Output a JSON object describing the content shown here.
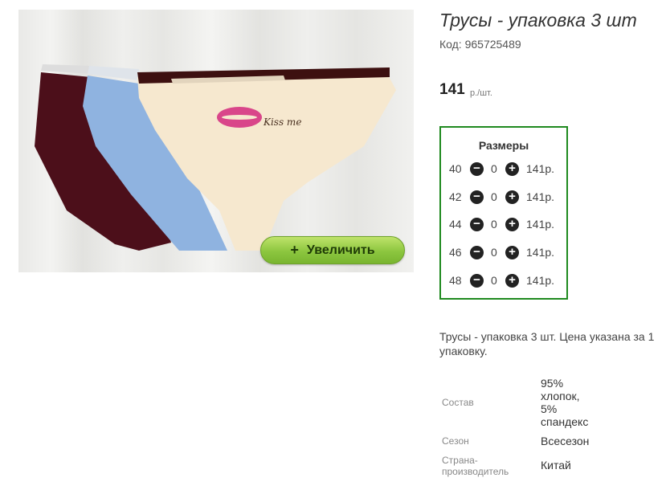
{
  "product": {
    "title": "Трусы - упаковка 3 шт",
    "code": "Код: 965725489",
    "price": "141",
    "price_unit": "р./шт.",
    "zoom_label": "Увеличить",
    "zoom_plus": "+",
    "print_text": "Kiss me"
  },
  "sizes": {
    "title": "Размеры",
    "rows": [
      {
        "size": "40",
        "qty": "0",
        "price": "141р."
      },
      {
        "size": "42",
        "qty": "0",
        "price": "141р."
      },
      {
        "size": "44",
        "qty": "0",
        "price": "141р."
      },
      {
        "size": "46",
        "qty": "0",
        "price": "141р."
      },
      {
        "size": "48",
        "qty": "0",
        "price": "141р."
      }
    ]
  },
  "description": "Трусы - упаковка 3 шт. Цена указана за 1 упаковку.",
  "properties": [
    {
      "label": "Состав",
      "value_lines": [
        "95%",
        "хлопок,",
        "5%",
        "спандекс"
      ]
    },
    {
      "label": "Сезон",
      "value_lines": [
        "Всесезон"
      ]
    },
    {
      "label_lines": [
        "Страна-",
        "производитель"
      ],
      "value_lines": [
        "Китай"
      ]
    }
  ]
}
